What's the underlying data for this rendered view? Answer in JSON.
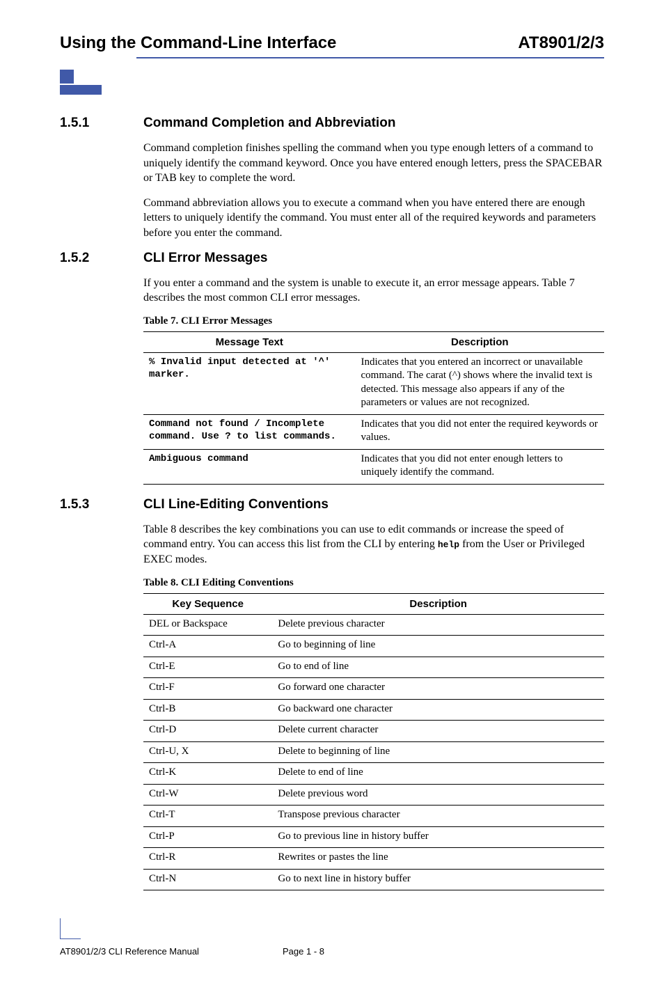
{
  "header": {
    "left": "Using the Command-Line Interface",
    "right": "AT8901/2/3"
  },
  "sections": {
    "s1": {
      "num": "1.5.1",
      "title": "Command Completion and Abbreviation"
    },
    "s2": {
      "num": "1.5.2",
      "title": "CLI Error Messages"
    },
    "s3": {
      "num": "1.5.3",
      "title": "CLI Line-Editing Conventions"
    }
  },
  "paras": {
    "p1": "Command completion finishes spelling the command when you type enough letters of a command to uniquely identify the command keyword. Once you have entered enough letters, press the SPACEBAR or TAB key to complete the word.",
    "p2": "Command abbreviation allows you to execute a command when you have entered there are enough letters to uniquely identify the command. You must enter all of the required keywords and parameters before you enter the command.",
    "p3": "If you enter a command and the system is unable to execute it, an error message appears. Table 7 describes the most common CLI error messages.",
    "p4a": "Table 8 describes the key combinations you can use to edit commands or increase the speed of command entry. You can access this list from the CLI by entering ",
    "p4b": "help",
    "p4c": " from the User or Privileged EXEC modes."
  },
  "table7": {
    "caption": "Table 7. CLI Error Messages",
    "col1": "Message Text",
    "col2": "Description",
    "rows": [
      {
        "msg": "% Invalid input detected at '^' marker.",
        "desc": "Indicates that you entered an incorrect or unavailable command. The carat (^) shows where the invalid text is detected. This message also appears if any of the parameters or values are not recognized."
      },
      {
        "msg": "Command not found / Incomplete command. Use ? to list commands.",
        "desc": "Indicates that you did not enter the required keywords or values."
      },
      {
        "msg": "Ambiguous command",
        "desc": "Indicates that you did not enter enough letters to uniquely identify the command."
      }
    ]
  },
  "table8": {
    "caption": "Table 8. CLI Editing Conventions",
    "col1": "Key Sequence",
    "col2": "Description",
    "rows": [
      {
        "k": "DEL or Backspace",
        "d": "Delete previous character"
      },
      {
        "k": "Ctrl-A",
        "d": "Go to beginning of line"
      },
      {
        "k": "Ctrl-E",
        "d": "Go to end of line"
      },
      {
        "k": "Ctrl-F",
        "d": "Go forward one character"
      },
      {
        "k": "Ctrl-B",
        "d": "Go backward one character"
      },
      {
        "k": "Ctrl-D",
        "d": "Delete current character"
      },
      {
        "k": "Ctrl-U, X",
        "d": "Delete to beginning of line"
      },
      {
        "k": "Ctrl-K",
        "d": "Delete to end of line"
      },
      {
        "k": "Ctrl-W",
        "d": "Delete previous word"
      },
      {
        "k": "Ctrl-T",
        "d": "Transpose previous character"
      },
      {
        "k": "Ctrl-P",
        "d": "Go to previous line in history buffer"
      },
      {
        "k": "Ctrl-R",
        "d": "Rewrites or pastes the line"
      },
      {
        "k": "Ctrl-N",
        "d": "Go to next line in history buffer"
      }
    ]
  },
  "footer": {
    "title": "AT8901/2/3 CLI Reference Manual",
    "page": "Page 1 - 8"
  }
}
